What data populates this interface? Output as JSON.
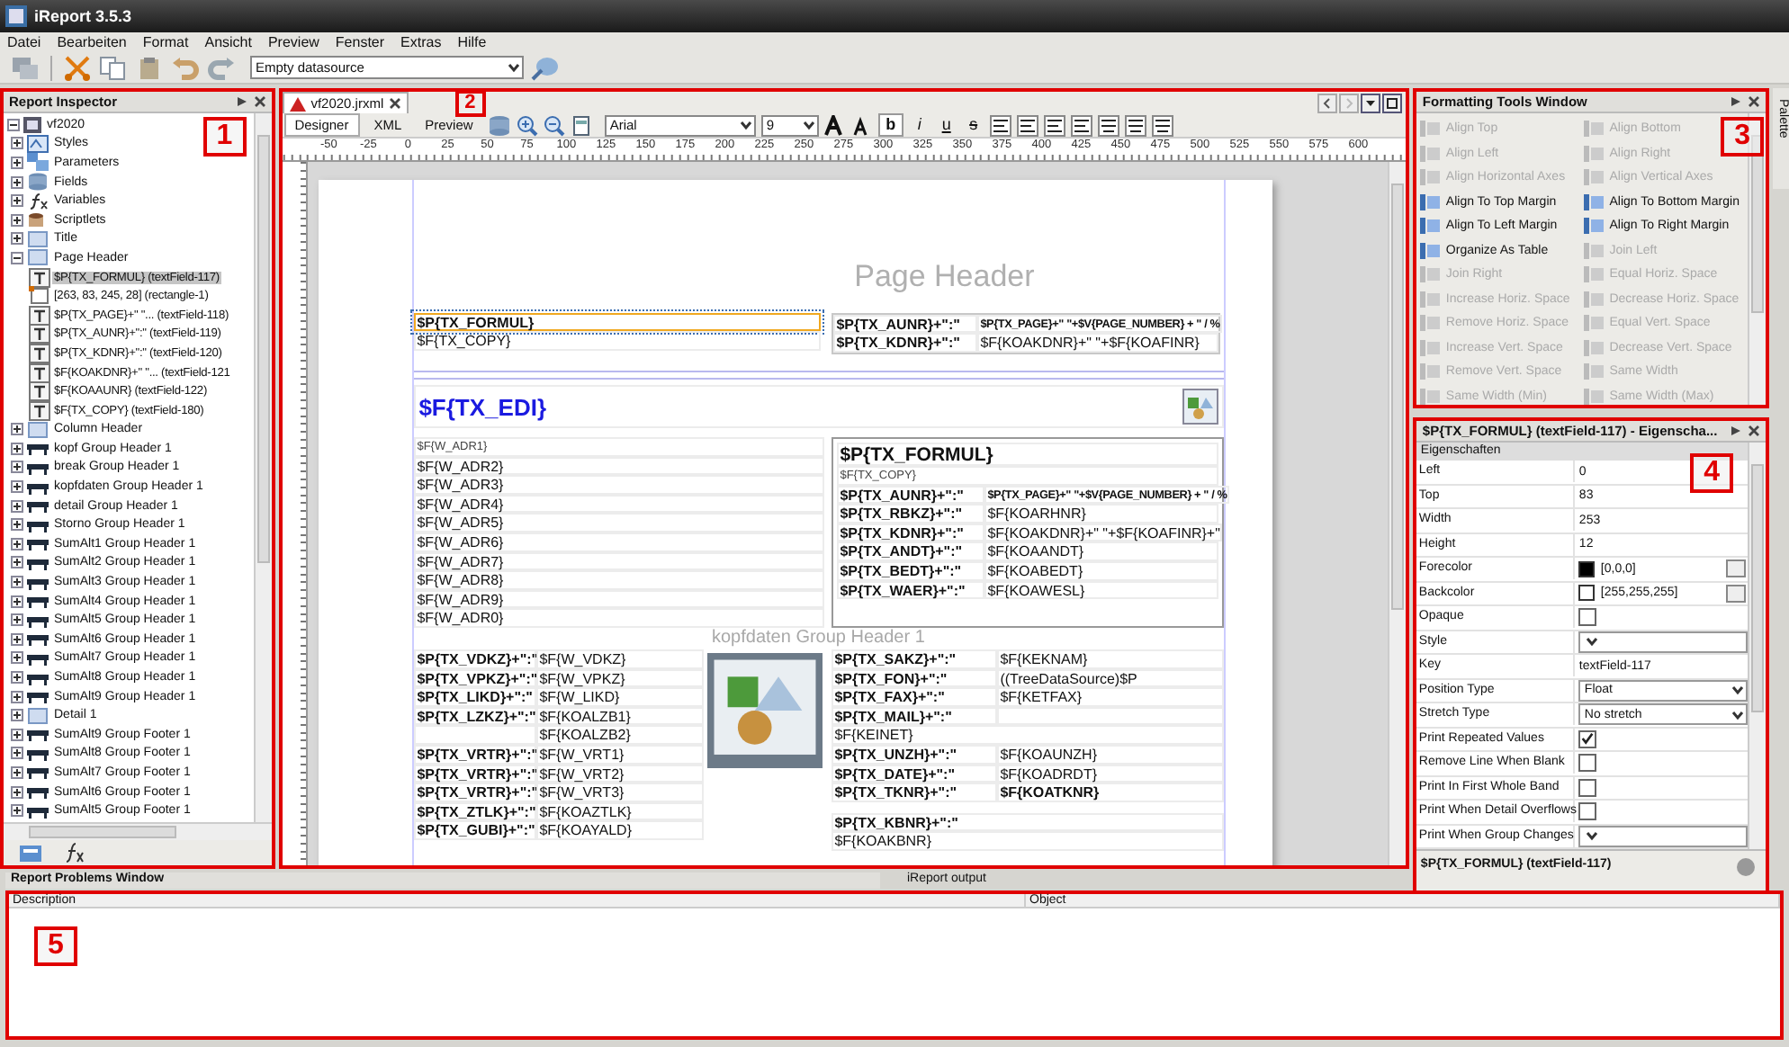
{
  "window": {
    "title": "iReport 3.5.3"
  },
  "menu": [
    "Datei",
    "Bearbeiten",
    "Format",
    "Ansicht",
    "Preview",
    "Fenster",
    "Extras",
    "Hilfe"
  ],
  "toolbar": {
    "datasource": "Empty datasource"
  },
  "inspector": {
    "title": "Report Inspector",
    "callout": "1",
    "tree": [
      {
        "label": "vf2020",
        "kind": "root",
        "expanded": true,
        "selected": false,
        "children": [
          {
            "label": "Styles",
            "kind": "styles",
            "expanded": false,
            "selected": false
          },
          {
            "label": "Parameters",
            "kind": "parameters",
            "expanded": false,
            "selected": false
          },
          {
            "label": "Fields",
            "kind": "fields",
            "expanded": false,
            "selected": false
          },
          {
            "label": "Variables",
            "kind": "variables",
            "expanded": false,
            "selected": false
          },
          {
            "label": "Scriptlets",
            "kind": "scriptlets",
            "expanded": false,
            "selected": false
          },
          {
            "label": "Title",
            "kind": "band",
            "expanded": false,
            "selected": false
          },
          {
            "label": "Page Header",
            "kind": "band",
            "expanded": true,
            "selected": false,
            "children": [
              {
                "label": "$P{TX_FORMUL} (textField-117)",
                "kind": "textfield",
                "selected": true
              },
              {
                "label": "[263, 83, 245, 28] (rectangle-1)",
                "kind": "rectangle",
                "selected": false
              },
              {
                "label": "$P{TX_PAGE}+\" \"... (textField-118)",
                "kind": "textfield",
                "selected": false
              },
              {
                "label": "$P{TX_AUNR}+\":\" (textField-119)",
                "kind": "textfield",
                "selected": false
              },
              {
                "label": "$P{TX_KDNR}+\":\" (textField-120)",
                "kind": "textfield",
                "selected": false
              },
              {
                "label": "$F{KOAKDNR}+\" \"... (textField-121",
                "kind": "textfield",
                "selected": false
              },
              {
                "label": "$F{KOAAUNR} (textField-122)",
                "kind": "textfield",
                "selected": false
              },
              {
                "label": "$F{TX_COPY} (textField-180)",
                "kind": "textfield",
                "selected": false
              }
            ]
          },
          {
            "label": "Column Header",
            "kind": "band",
            "expanded": false,
            "selected": false
          },
          {
            "label": "kopf Group Header 1",
            "kind": "group",
            "expanded": false,
            "selected": false
          },
          {
            "label": "break Group Header 1",
            "kind": "group",
            "expanded": false,
            "selected": false
          },
          {
            "label": "kopfdaten Group Header 1",
            "kind": "group",
            "expanded": false,
            "selected": false
          },
          {
            "label": "detail Group Header 1",
            "kind": "group",
            "expanded": false,
            "selected": false
          },
          {
            "label": "Storno Group Header 1",
            "kind": "group",
            "expanded": false,
            "selected": false
          },
          {
            "label": "SumAlt1 Group Header 1",
            "kind": "group",
            "expanded": false,
            "selected": false
          },
          {
            "label": "SumAlt2 Group Header 1",
            "kind": "group",
            "expanded": false,
            "selected": false
          },
          {
            "label": "SumAlt3 Group Header 1",
            "kind": "group",
            "expanded": false,
            "selected": false
          },
          {
            "label": "SumAlt4 Group Header 1",
            "kind": "group",
            "expanded": false,
            "selected": false
          },
          {
            "label": "SumAlt5 Group Header 1",
            "kind": "group",
            "expanded": false,
            "selected": false
          },
          {
            "label": "SumAlt6 Group Header 1",
            "kind": "group",
            "expanded": false,
            "selected": false
          },
          {
            "label": "SumAlt7 Group Header 1",
            "kind": "group",
            "expanded": false,
            "selected": false
          },
          {
            "label": "SumAlt8 Group Header 1",
            "kind": "group",
            "expanded": false,
            "selected": false
          },
          {
            "label": "SumAlt9 Group Header 1",
            "kind": "group",
            "expanded": false,
            "selected": false
          },
          {
            "label": "Detail 1",
            "kind": "band",
            "expanded": false,
            "selected": false
          },
          {
            "label": "SumAlt9 Group Footer 1",
            "kind": "group",
            "expanded": false,
            "selected": false
          },
          {
            "label": "SumAlt8 Group Footer 1",
            "kind": "group",
            "expanded": false,
            "selected": false
          },
          {
            "label": "SumAlt7 Group Footer 1",
            "kind": "group",
            "expanded": false,
            "selected": false
          },
          {
            "label": "SumAlt6 Group Footer 1",
            "kind": "group",
            "expanded": false,
            "selected": false
          },
          {
            "label": "SumAlt5 Group Footer 1",
            "kind": "group",
            "expanded": false,
            "selected": false
          }
        ]
      }
    ]
  },
  "designer": {
    "callout": "2",
    "file_tab": "vf2020.jrxml",
    "views": [
      {
        "label": "Designer",
        "selected": true
      },
      {
        "label": "XML",
        "selected": false
      },
      {
        "label": "Preview",
        "selected": false
      }
    ],
    "font": "Arial",
    "size": "9",
    "styles": [
      {
        "label": "b",
        "kind": "bold",
        "selected": true
      },
      {
        "label": "i",
        "kind": "italic",
        "selected": false
      },
      {
        "label": "u",
        "kind": "underline",
        "selected": false
      },
      {
        "label": "s",
        "kind": "strike",
        "selected": false
      }
    ],
    "ruler": [
      "-50",
      "-25",
      "0",
      "25",
      "50",
      "75",
      "100",
      "125",
      "150",
      "175",
      "200",
      "225",
      "250",
      "275",
      "300",
      "325",
      "350",
      "375",
      "400",
      "425",
      "450",
      "475",
      "500",
      "525",
      "550",
      "575",
      "600"
    ],
    "page": {
      "header_label": "Page Header",
      "header_left": [
        {
          "text": "$P{TX_FORMUL}",
          "bold": true,
          "selected": true
        },
        {
          "text": "$F{TX_COPY}",
          "bold": false,
          "selected": false
        }
      ],
      "header_right": [
        {
          "label": "$P{TX_AUNR}+\":\"",
          "value": "$P{TX_PAGE}+\" \"+$V{PAGE_NUMBER} + \" / %",
          "value_bold": true
        },
        {
          "label": "$P{TX_KDNR}+\":\"",
          "value": "$F{KOAKDNR}+\" \"+$F{KOAFINR}",
          "value_bold": false
        }
      ],
      "title_field": "$F{TX_EDI}",
      "address": [
        "$F{W_ADR1}",
        "$F{W_ADR2}",
        "$F{W_ADR3}",
        "$F{W_ADR4}",
        "$F{W_ADR5}",
        "$F{W_ADR6}",
        "$F{W_ADR7}",
        "$F{W_ADR8}",
        "$F{W_ADR9}",
        "$F{W_ADR0}"
      ],
      "info_title": "$P{TX_FORMUL}",
      "info_copy": "$F{TX_COPY}",
      "info_rows": [
        {
          "label": "$P{TX_AUNR}+\":\"",
          "value": "$P{TX_PAGE}+\" \"+$V{PAGE_NUMBER} + \" / %",
          "value_bold": true
        },
        {
          "label": "$P{TX_RBKZ}+\":\"",
          "value": "$F{KOARHNR}",
          "value_bold": false
        },
        {
          "label": "$P{TX_KDNR}+\":\"",
          "value": "$F{KOAKDNR}+\" \"+$F{KOAFINR}+\"",
          "value_bold": false
        },
        {
          "label": "$P{TX_ANDT}+\":\"",
          "value": "$F{KOAANDT}",
          "value_bold": false
        },
        {
          "label": "$P{TX_BEDT}+\":\"",
          "value": "$F{KOABEDT}",
          "value_bold": false
        },
        {
          "label": "$P{TX_WAER}+\":\"",
          "value": "$F{KOAWESL}",
          "value_bold": false
        }
      ],
      "band_label": "kopfdaten Group Header 1",
      "left_rows": [
        {
          "label": "$P{TX_VDKZ}+\":\"",
          "value": "$F{W_VDKZ}"
        },
        {
          "label": "$P{TX_VPKZ}+\":\"",
          "value": "$F{W_VPKZ}"
        },
        {
          "label": "$P{TX_LIKD}+\":\"",
          "value": "$F{W_LIKD}"
        },
        {
          "label": "$P{TX_LZKZ}+\":\"",
          "value": "$F{KOALZB1}"
        },
        {
          "value": "$F{KOALZB2}"
        },
        {
          "label": "$P{TX_VRTR}+\":\"",
          "value": "$F{W_VRT1}"
        },
        {
          "label": "$P{TX_VRTR}+\":\"",
          "value": "$F{W_VRT2}"
        },
        {
          "label": "$P{TX_VRTR}+\":\"",
          "value": "$F{W_VRT3}"
        },
        {
          "label": "$P{TX_ZTLK}+\":\"",
          "value": "$F{KOAZTLK}"
        },
        {
          "label": "$P{TX_GUBI}+\":\"",
          "value": "$F{KOAYALD}"
        }
      ],
      "right_rows": [
        {
          "kind": "pair",
          "label": "$P{TX_SAKZ}+\":\"",
          "value": "$F{KEKNAM}",
          "value_bold": false
        },
        {
          "kind": "pair",
          "label": "$P{TX_FON}+\":\"",
          "value": "((TreeDataSource)$P",
          "value_bold": false
        },
        {
          "kind": "pair",
          "label": "$P{TX_FAX}+\":\"",
          "value": "$F{KETFAX}",
          "value_bold": false
        },
        {
          "kind": "pair",
          "label": "$P{TX_MAIL}+\":\""
        },
        {
          "kind": "single",
          "value": "$F{KEINET}"
        },
        {
          "kind": "pair",
          "label": "$P{TX_UNZH}+\":\"",
          "value": "$F{KOAUNZH}",
          "value_bold": false
        },
        {
          "kind": "pair",
          "label": "$P{TX_DATE}+\":\"",
          "value": "$F{KOADRDT}",
          "value_bold": false
        },
        {
          "kind": "pair",
          "label": "$P{TX_TKNR}+\":\"",
          "value": "$F{KOATKNR}",
          "value_bold": true
        }
      ],
      "right_footer": [
        {
          "kind": "pair",
          "label": "$P{TX_KBNR}+\":\""
        },
        {
          "kind": "single",
          "value": "$F{KOAKBNR}"
        }
      ]
    }
  },
  "formatting": {
    "title": "Formatting Tools Window",
    "callout": "3",
    "tools": [
      {
        "label": "Align Top",
        "disabled": true
      },
      {
        "label": "Align Bottom",
        "disabled": true
      },
      {
        "label": "Align Left",
        "disabled": true
      },
      {
        "label": "Align Right",
        "disabled": true
      },
      {
        "label": "Align Horizontal Axes",
        "disabled": true
      },
      {
        "label": "Align Vertical Axes",
        "disabled": true
      },
      {
        "label": "Align To Top Margin",
        "disabled": false
      },
      {
        "label": "Align To Bottom Margin",
        "disabled": false
      },
      {
        "label": "Align To Left Margin",
        "disabled": false
      },
      {
        "label": "Align To Right Margin",
        "disabled": false
      },
      {
        "label": "Organize As Table",
        "disabled": false
      },
      {
        "label": "Join Left",
        "disabled": true
      },
      {
        "label": "Join Right",
        "disabled": true
      },
      {
        "label": "Equal Horiz. Space",
        "disabled": true
      },
      {
        "label": "Increase Horiz. Space",
        "disabled": true
      },
      {
        "label": "Decrease Horiz. Space",
        "disabled": true
      },
      {
        "label": "Remove Horiz. Space",
        "disabled": true
      },
      {
        "label": "Equal Vert. Space",
        "disabled": true
      },
      {
        "label": "Increase Vert. Space",
        "disabled": true
      },
      {
        "label": "Decrease Vert. Space",
        "disabled": true
      },
      {
        "label": "Remove Vert. Space",
        "disabled": true
      },
      {
        "label": "Same Width",
        "disabled": true
      },
      {
        "label": "Same Width (Min)",
        "disabled": true
      },
      {
        "label": "Same Width (Max)",
        "disabled": true
      }
    ]
  },
  "properties": {
    "title": "$P{TX_FORMUL} (textField-117) - Eigenscha...",
    "callout": "4",
    "section": "Eigenschaften",
    "rows": [
      {
        "name": "Left",
        "kind": "text",
        "value": "0"
      },
      {
        "name": "Top",
        "kind": "text",
        "value": "83"
      },
      {
        "name": "Width",
        "kind": "text",
        "value": "253"
      },
      {
        "name": "Height",
        "kind": "text",
        "value": "12"
      },
      {
        "name": "Forecolor",
        "kind": "color",
        "value": "[0,0,0]",
        "color": "#000000"
      },
      {
        "name": "Backcolor",
        "kind": "color",
        "value": "[255,255,255]",
        "color": "#ffffff"
      },
      {
        "name": "Opaque",
        "kind": "check",
        "checked": false
      },
      {
        "name": "Style",
        "kind": "select"
      },
      {
        "name": "Key",
        "kind": "text",
        "value": "textField-117"
      },
      {
        "name": "Position Type",
        "kind": "select",
        "value": "Float"
      },
      {
        "name": "Stretch Type",
        "kind": "select",
        "value": "No stretch"
      },
      {
        "name": "Print Repeated Values",
        "kind": "check",
        "checked": true
      },
      {
        "name": "Remove Line When Blank",
        "kind": "check",
        "checked": false
      },
      {
        "name": "Print In First Whole Band",
        "kind": "check",
        "checked": false
      },
      {
        "name": "Print When Detail Overflows",
        "kind": "check",
        "checked": false
      },
      {
        "name": "Print When Group Changes",
        "kind": "select"
      }
    ],
    "footer": "$P{TX_FORMUL} (textField-117)"
  },
  "palette": {
    "label": "Palette"
  },
  "bottom": {
    "callout": "5",
    "tabs": [
      {
        "label": "Report Problems Window",
        "selected": true
      },
      {
        "label": "iReport output",
        "selected": false
      }
    ],
    "columns": [
      "Description",
      "Object"
    ]
  }
}
